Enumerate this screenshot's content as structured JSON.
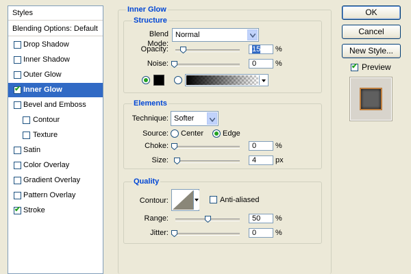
{
  "styles_list": {
    "header": "Styles",
    "blending": "Blending Options: Default",
    "items": [
      {
        "label": "Drop Shadow",
        "checked": false
      },
      {
        "label": "Inner Shadow",
        "checked": false
      },
      {
        "label": "Outer Glow",
        "checked": false
      },
      {
        "label": "Inner Glow",
        "checked": true,
        "selected": true
      },
      {
        "label": "Bevel and Emboss",
        "checked": false
      },
      {
        "label": "Contour",
        "checked": false
      },
      {
        "label": "Texture",
        "checked": false
      },
      {
        "label": "Satin",
        "checked": false
      },
      {
        "label": "Color Overlay",
        "checked": false
      },
      {
        "label": "Gradient Overlay",
        "checked": false
      },
      {
        "label": "Pattern Overlay",
        "checked": false
      },
      {
        "label": "Stroke",
        "checked": true
      }
    ]
  },
  "inner_glow": {
    "title": "Inner Glow",
    "structure": {
      "title": "Structure",
      "blend_mode_label": "Blend Mode:",
      "blend_mode": "Normal",
      "opacity_label": "Opacity:",
      "opacity": "15",
      "opacity_unit": "%",
      "noise_label": "Noise:",
      "noise": "0",
      "noise_unit": "%",
      "color_swatch": "#000000",
      "color_mode": "solid"
    },
    "elements": {
      "title": "Elements",
      "technique_label": "Technique:",
      "technique": "Softer",
      "source_label": "Source:",
      "source_center": "Center",
      "source_edge": "Edge",
      "source_selected": "Edge",
      "choke_label": "Choke:",
      "choke": "0",
      "choke_unit": "%",
      "size_label": "Size:",
      "size": "4",
      "size_unit": "px"
    },
    "quality": {
      "title": "Quality",
      "contour_label": "Contour:",
      "anti_aliased_label": "Anti-aliased",
      "anti_aliased": false,
      "range_label": "Range:",
      "range": "50",
      "range_unit": "%",
      "jitter_label": "Jitter:",
      "jitter": "0",
      "jitter_unit": "%"
    }
  },
  "buttons": {
    "ok": "OK",
    "cancel": "Cancel",
    "new_style": "New Style...",
    "preview_label": "Preview",
    "preview_checked": true
  },
  "colors": {
    "accent": "#316ac5",
    "check": "#21a121",
    "legend": "#0046d5"
  }
}
